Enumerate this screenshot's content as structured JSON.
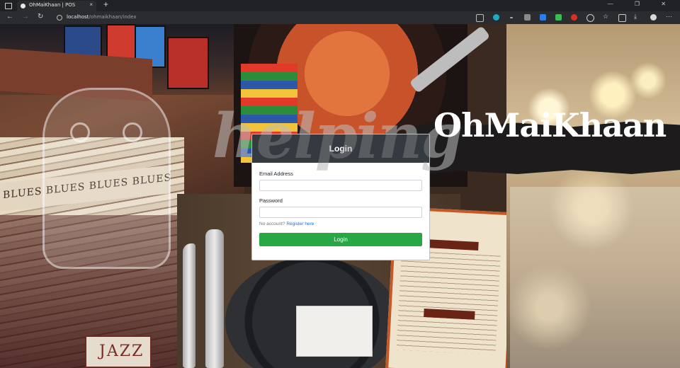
{
  "browser": {
    "tab_title": "OhMaiKhaan | POS",
    "tab_close": "×",
    "new_tab": "+",
    "window_controls": "— ❐ ✕",
    "back": "←",
    "forward": "→",
    "reload": "↻",
    "url_host": "localhost",
    "url_path": "/ohmaikhaan/index",
    "menu": "···"
  },
  "hero": {
    "brand_logo": "OhMaiKhaan",
    "watermark": "helping",
    "blues_label": "BLUES BLUES BLUES BLUES",
    "jazz_label": "JAZZ"
  },
  "login": {
    "title": "Login",
    "email_label": "Email Address",
    "email_value": "",
    "password_label": "Password",
    "password_value": "",
    "no_account_text": "No account?",
    "register_link": "Register here",
    "submit_label": "Login"
  },
  "colors": {
    "card_header": "#343a40",
    "button": "#28a745",
    "link": "#0d6efd"
  }
}
